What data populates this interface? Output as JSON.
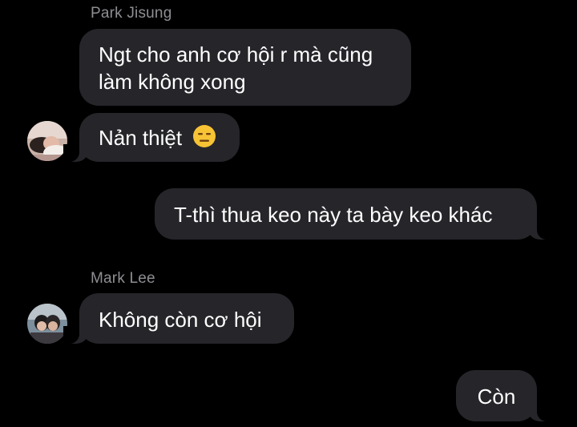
{
  "chat": {
    "messages": [
      {
        "sender": "Park Jisung",
        "text": "Ngt cho anh cơ hội r mà cũng làm không xong",
        "direction": "incoming"
      },
      {
        "text": "Nản thiệt",
        "emoji": "expressionless-face-icon",
        "direction": "incoming"
      },
      {
        "text": "T-thì thua keo này ta bày keo khác",
        "direction": "outgoing"
      },
      {
        "sender": "Mark Lee",
        "text": "Không còn cơ hội",
        "direction": "incoming"
      },
      {
        "text": "Còn",
        "direction": "outgoing"
      }
    ]
  },
  "colors": {
    "background": "#000000",
    "bubble": "#26252a",
    "sender_name": "#8e8e93",
    "text": "#ffffff",
    "emoji": "#f7c335"
  }
}
